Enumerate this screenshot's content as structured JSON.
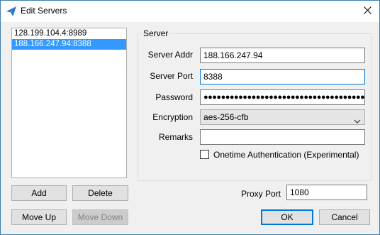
{
  "window": {
    "title": "Edit Servers",
    "app_icon": "paper-plane-icon",
    "close_icon": "close-icon",
    "accent_color": "#0078d7",
    "selection_color": "#3399ff"
  },
  "servers": [
    {
      "label": "128.199.104.4:8989",
      "selected": false
    },
    {
      "label": "188.166.247.94:8388",
      "selected": true
    }
  ],
  "server_group": {
    "legend": "Server",
    "server_addr_label": "Server Addr",
    "server_addr_value": "188.166.247.94",
    "server_port_label": "Server Port",
    "server_port_value": "8388",
    "password_label": "Password",
    "password_masked": "●●●●●●●●●●●●●●●●●●●●●●●●●●●●●●●●●●●●●●●●",
    "encryption_label": "Encryption",
    "encryption_value": "aes-256-cfb",
    "remarks_label": "Remarks",
    "remarks_value": "",
    "onetime_auth_label": "Onetime Authentication (Experimental)",
    "onetime_auth_checked": false
  },
  "buttons": {
    "add": "Add",
    "delete": "Delete",
    "move_up": "Move Up",
    "move_down": "Move Down",
    "ok": "OK",
    "cancel": "Cancel"
  },
  "proxy": {
    "label": "Proxy Port",
    "value": "1080"
  }
}
